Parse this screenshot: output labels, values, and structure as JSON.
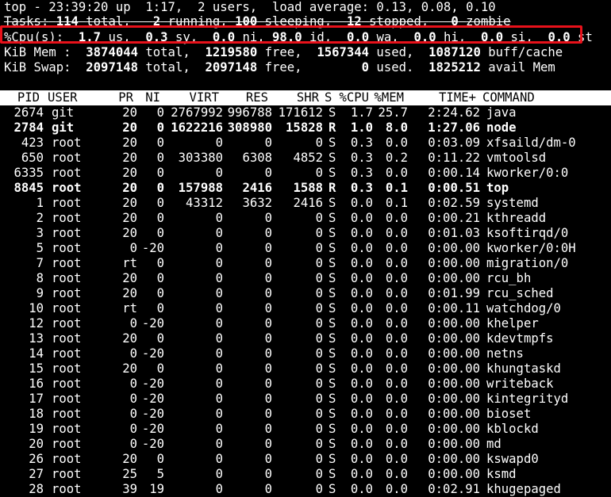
{
  "summary": {
    "line1": "top - 23:39:20 up  1:17,  2 users,  load average: 0.13, 0.08, 0.10",
    "tasks": {
      "label": "Tasks:",
      "total": "114",
      "total_label": "total,",
      "running": "2",
      "running_label": "running,",
      "sleeping": "100",
      "sleeping_label": "sleeping,",
      "stopped": "12",
      "stopped_label": "stopped,",
      "zombie": "0",
      "zombie_label": "zombie"
    },
    "cpu": {
      "label": "%Cpu(s):",
      "us": "1.7",
      "sy": "0.3",
      "ni": "0.0",
      "id": "98.0",
      "wa": "0.0",
      "hi": "0.0",
      "si": "0.0",
      "st": "0.0"
    },
    "mem": {
      "label": "KiB Mem :",
      "total": "3874044",
      "free": "1219580",
      "used": "1567344",
      "buff_cache": "1087120"
    },
    "swap": {
      "label": "KiB Swap:",
      "total": "2097148",
      "free": "2097148",
      "used": "0",
      "avail": "1825212"
    }
  },
  "columns": [
    "PID",
    "USER",
    "PR",
    "NI",
    "VIRT",
    "RES",
    "SHR",
    "S",
    "%CPU",
    "%MEM",
    "TIME+",
    "COMMAND"
  ],
  "processes": [
    {
      "pid": "2674",
      "user": "git",
      "pr": "20",
      "ni": "0",
      "virt": "2767992",
      "res": "996788",
      "shr": "171612",
      "s": "S",
      "cpu": "1.7",
      "mem": "25.7",
      "time": "2:24.62",
      "cmd": "java",
      "bold": false
    },
    {
      "pid": "2784",
      "user": "git",
      "pr": "20",
      "ni": "0",
      "virt": "1622216",
      "res": "308980",
      "shr": "15828",
      "s": "R",
      "cpu": "1.0",
      "mem": "8.0",
      "time": "1:27.06",
      "cmd": "node",
      "bold": true
    },
    {
      "pid": "423",
      "user": "root",
      "pr": "20",
      "ni": "0",
      "virt": "0",
      "res": "0",
      "shr": "0",
      "s": "S",
      "cpu": "0.3",
      "mem": "0.0",
      "time": "0:03.09",
      "cmd": "xfsaild/dm-0",
      "bold": false
    },
    {
      "pid": "650",
      "user": "root",
      "pr": "20",
      "ni": "0",
      "virt": "303380",
      "res": "6308",
      "shr": "4852",
      "s": "S",
      "cpu": "0.3",
      "mem": "0.2",
      "time": "0:11.22",
      "cmd": "vmtoolsd",
      "bold": false
    },
    {
      "pid": "6335",
      "user": "root",
      "pr": "20",
      "ni": "0",
      "virt": "0",
      "res": "0",
      "shr": "0",
      "s": "S",
      "cpu": "0.3",
      "mem": "0.0",
      "time": "0:00.14",
      "cmd": "kworker/0:0",
      "bold": false
    },
    {
      "pid": "8845",
      "user": "root",
      "pr": "20",
      "ni": "0",
      "virt": "157988",
      "res": "2416",
      "shr": "1588",
      "s": "R",
      "cpu": "0.3",
      "mem": "0.1",
      "time": "0:00.51",
      "cmd": "top",
      "bold": true
    },
    {
      "pid": "1",
      "user": "root",
      "pr": "20",
      "ni": "0",
      "virt": "43312",
      "res": "3632",
      "shr": "2416",
      "s": "S",
      "cpu": "0.0",
      "mem": "0.1",
      "time": "0:02.59",
      "cmd": "systemd",
      "bold": false
    },
    {
      "pid": "2",
      "user": "root",
      "pr": "20",
      "ni": "0",
      "virt": "0",
      "res": "0",
      "shr": "0",
      "s": "S",
      "cpu": "0.0",
      "mem": "0.0",
      "time": "0:00.21",
      "cmd": "kthreadd",
      "bold": false
    },
    {
      "pid": "3",
      "user": "root",
      "pr": "20",
      "ni": "0",
      "virt": "0",
      "res": "0",
      "shr": "0",
      "s": "S",
      "cpu": "0.0",
      "mem": "0.0",
      "time": "0:01.03",
      "cmd": "ksoftirqd/0",
      "bold": false
    },
    {
      "pid": "5",
      "user": "root",
      "pr": "0",
      "ni": "-20",
      "virt": "0",
      "res": "0",
      "shr": "0",
      "s": "S",
      "cpu": "0.0",
      "mem": "0.0",
      "time": "0:00.00",
      "cmd": "kworker/0:0H",
      "bold": false
    },
    {
      "pid": "7",
      "user": "root",
      "pr": "rt",
      "ni": "0",
      "virt": "0",
      "res": "0",
      "shr": "0",
      "s": "S",
      "cpu": "0.0",
      "mem": "0.0",
      "time": "0:00.00",
      "cmd": "migration/0",
      "bold": false
    },
    {
      "pid": "8",
      "user": "root",
      "pr": "20",
      "ni": "0",
      "virt": "0",
      "res": "0",
      "shr": "0",
      "s": "S",
      "cpu": "0.0",
      "mem": "0.0",
      "time": "0:00.00",
      "cmd": "rcu_bh",
      "bold": false
    },
    {
      "pid": "9",
      "user": "root",
      "pr": "20",
      "ni": "0",
      "virt": "0",
      "res": "0",
      "shr": "0",
      "s": "S",
      "cpu": "0.0",
      "mem": "0.0",
      "time": "0:01.99",
      "cmd": "rcu_sched",
      "bold": false
    },
    {
      "pid": "10",
      "user": "root",
      "pr": "rt",
      "ni": "0",
      "virt": "0",
      "res": "0",
      "shr": "0",
      "s": "S",
      "cpu": "0.0",
      "mem": "0.0",
      "time": "0:00.11",
      "cmd": "watchdog/0",
      "bold": false
    },
    {
      "pid": "12",
      "user": "root",
      "pr": "0",
      "ni": "-20",
      "virt": "0",
      "res": "0",
      "shr": "0",
      "s": "S",
      "cpu": "0.0",
      "mem": "0.0",
      "time": "0:00.00",
      "cmd": "khelper",
      "bold": false
    },
    {
      "pid": "13",
      "user": "root",
      "pr": "20",
      "ni": "0",
      "virt": "0",
      "res": "0",
      "shr": "0",
      "s": "S",
      "cpu": "0.0",
      "mem": "0.0",
      "time": "0:00.00",
      "cmd": "kdevtmpfs",
      "bold": false
    },
    {
      "pid": "14",
      "user": "root",
      "pr": "0",
      "ni": "-20",
      "virt": "0",
      "res": "0",
      "shr": "0",
      "s": "S",
      "cpu": "0.0",
      "mem": "0.0",
      "time": "0:00.00",
      "cmd": "netns",
      "bold": false
    },
    {
      "pid": "15",
      "user": "root",
      "pr": "20",
      "ni": "0",
      "virt": "0",
      "res": "0",
      "shr": "0",
      "s": "S",
      "cpu": "0.0",
      "mem": "0.0",
      "time": "0:00.00",
      "cmd": "khungtaskd",
      "bold": false
    },
    {
      "pid": "16",
      "user": "root",
      "pr": "0",
      "ni": "-20",
      "virt": "0",
      "res": "0",
      "shr": "0",
      "s": "S",
      "cpu": "0.0",
      "mem": "0.0",
      "time": "0:00.00",
      "cmd": "writeback",
      "bold": false
    },
    {
      "pid": "17",
      "user": "root",
      "pr": "0",
      "ni": "-20",
      "virt": "0",
      "res": "0",
      "shr": "0",
      "s": "S",
      "cpu": "0.0",
      "mem": "0.0",
      "time": "0:00.00",
      "cmd": "kintegrityd",
      "bold": false
    },
    {
      "pid": "18",
      "user": "root",
      "pr": "0",
      "ni": "-20",
      "virt": "0",
      "res": "0",
      "shr": "0",
      "s": "S",
      "cpu": "0.0",
      "mem": "0.0",
      "time": "0:00.00",
      "cmd": "bioset",
      "bold": false
    },
    {
      "pid": "19",
      "user": "root",
      "pr": "0",
      "ni": "-20",
      "virt": "0",
      "res": "0",
      "shr": "0",
      "s": "S",
      "cpu": "0.0",
      "mem": "0.0",
      "time": "0:00.00",
      "cmd": "kblockd",
      "bold": false
    },
    {
      "pid": "20",
      "user": "root",
      "pr": "0",
      "ni": "-20",
      "virt": "0",
      "res": "0",
      "shr": "0",
      "s": "S",
      "cpu": "0.0",
      "mem": "0.0",
      "time": "0:00.00",
      "cmd": "md",
      "bold": false
    },
    {
      "pid": "26",
      "user": "root",
      "pr": "20",
      "ni": "0",
      "virt": "0",
      "res": "0",
      "shr": "0",
      "s": "S",
      "cpu": "0.0",
      "mem": "0.0",
      "time": "0:00.00",
      "cmd": "kswapd0",
      "bold": false
    },
    {
      "pid": "27",
      "user": "root",
      "pr": "25",
      "ni": "5",
      "virt": "0",
      "res": "0",
      "shr": "0",
      "s": "S",
      "cpu": "0.0",
      "mem": "0.0",
      "time": "0:00.00",
      "cmd": "ksmd",
      "bold": false
    },
    {
      "pid": "28",
      "user": "root",
      "pr": "39",
      "ni": "19",
      "virt": "0",
      "res": "0",
      "shr": "0",
      "s": "S",
      "cpu": "0.0",
      "mem": "0.0",
      "time": "0:02.91",
      "cmd": "khugepaged",
      "bold": false
    }
  ],
  "colors": {
    "background": "#000000",
    "text": "#ffffff",
    "header_bg": "#ffffff",
    "header_text": "#000000",
    "highlight_box": "#e8111a"
  }
}
